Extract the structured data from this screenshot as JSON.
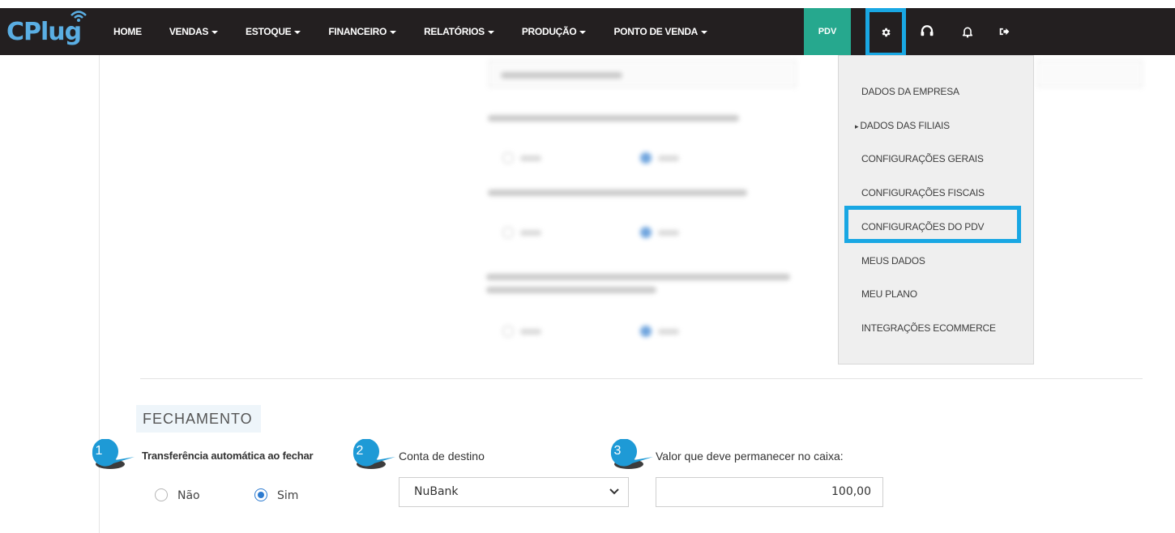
{
  "brand": {
    "logo_text": "CPlug"
  },
  "nav": {
    "items": [
      {
        "label": "HOME",
        "dropdown": false
      },
      {
        "label": "VENDAS",
        "dropdown": true
      },
      {
        "label": "ESTOQUE",
        "dropdown": true
      },
      {
        "label": "FINANCEIRO",
        "dropdown": true
      },
      {
        "label": "RELATÓRIOS",
        "dropdown": true
      },
      {
        "label": "PRODUÇÃO",
        "dropdown": true
      },
      {
        "label": "PONTO DE VENDA",
        "dropdown": true
      }
    ],
    "pdv_label": "PDV",
    "icons": [
      "gear-icon",
      "support-icon",
      "bell-icon",
      "logout-icon"
    ]
  },
  "settings_menu": {
    "items": [
      {
        "label": "DADOS DA EMPRESA"
      },
      {
        "label": "DADOS DAS FILIAIS",
        "has_submenu": true
      },
      {
        "label": "CONFIGURAÇÕES GERAIS"
      },
      {
        "label": "CONFIGURAÇÕES FISCAIS"
      },
      {
        "label": "CONFIGURAÇÕES DO PDV",
        "highlighted": true
      },
      {
        "label": "MEUS DADOS"
      },
      {
        "label": "MEU PLANO"
      },
      {
        "label": "INTEGRAÇÕES ECOMMERCE"
      }
    ],
    "submenu_marker": "▸"
  },
  "fechamento": {
    "title": "FECHAMENTO",
    "step1": {
      "number": "1",
      "label": "Transferência automática ao fechar"
    },
    "step2": {
      "number": "2",
      "label": "Conta de destino"
    },
    "step3": {
      "number": "3",
      "label": "Valor que deve permanecer no caixa:"
    },
    "radio_no": {
      "label": "Não",
      "checked": false
    },
    "radio_yes": {
      "label": "Sim",
      "checked": true
    },
    "conta_destino_value": "NuBank",
    "valor_caixa_value": "100,00"
  },
  "colors": {
    "topbar": "#231f20",
    "pdv": "#26a88e",
    "highlight": "#19a7e3",
    "bubble": "#1e9ad6"
  }
}
